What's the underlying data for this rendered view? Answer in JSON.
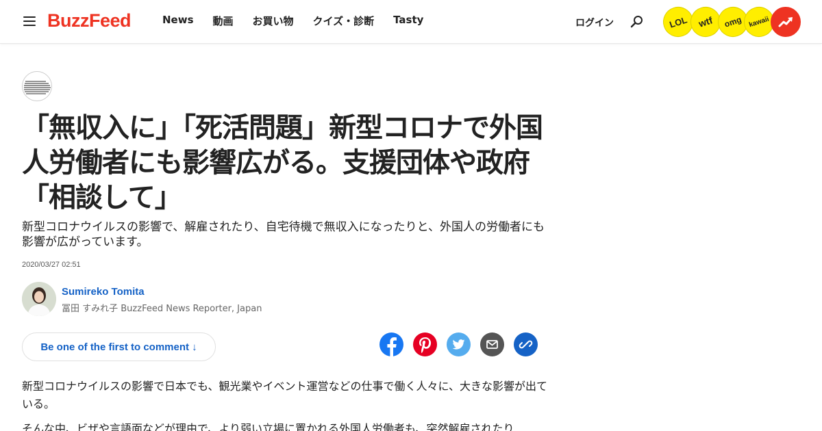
{
  "header": {
    "logo_text": "BuzzFeed",
    "nav": [
      "News",
      "動画",
      "お買い物",
      "クイズ・診断",
      "Tasty"
    ],
    "login": "ログイン",
    "badges": [
      "LOL",
      "wtf",
      "omg",
      "kawaii"
    ],
    "brand_color": "#ee3322",
    "badge_color": "#ffee00"
  },
  "article": {
    "headline": "「無収入に」「死活問題」新型コロナで外国人労働者にも影響広がる。支援団体や政府「相談して」",
    "dek": "新型コロナウイルスの影響で、解雇されたり、自宅待機で無収入になったりと、外国人の労働者にも影響が広がっています。",
    "date": "2020/03/27 02:51",
    "author_name": "Sumireko Tomita",
    "author_title": "冨田 すみれ子 BuzzFeed News Reporter, Japan",
    "comment_label": "Be one of the first to comment ↓",
    "link_color": "#1562c6",
    "paragraphs": [
      "新型コロナウイルスの影響で日本でも、観光業やイベント運営などの仕事で働く人々に、大きな影響が出ている。",
      "そんな中、ビザや言語面などが理由で、より弱い立場に置かれる外国人労働者も、突然解雇されたり"
    ]
  },
  "share": {
    "icons": [
      "facebook-icon",
      "pinterest-icon",
      "twitter-icon",
      "email-icon",
      "link-icon"
    ],
    "colors": {
      "facebook": "#1877f2",
      "pinterest": "#e60023",
      "twitter": "#55acee",
      "email": "#555555",
      "link": "#1562c6"
    }
  }
}
